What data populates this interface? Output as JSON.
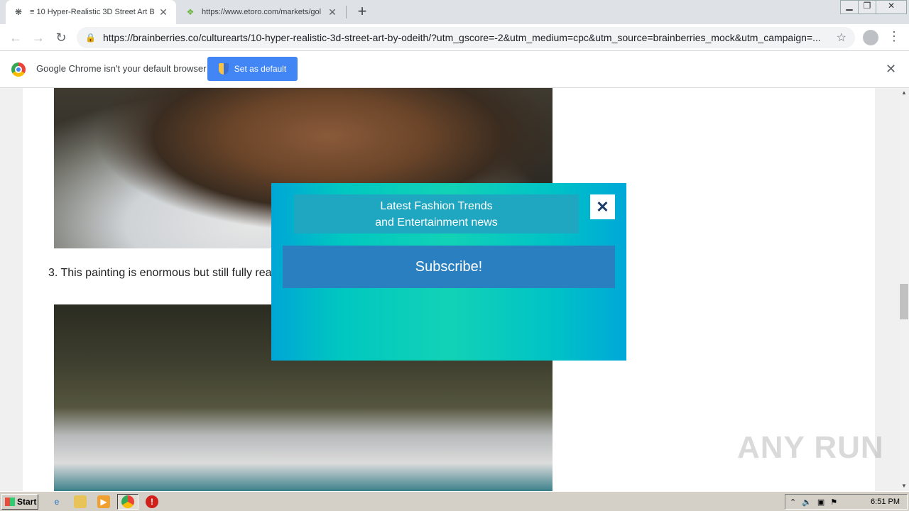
{
  "tabs": [
    {
      "title": "≡ 10 Hyper-Realistic 3D Street Art B",
      "favicon": "brainberries-icon",
      "active": true
    },
    {
      "title": "https://www.etoro.com/markets/gol",
      "favicon": "etoro-icon",
      "active": false
    }
  ],
  "toolbar": {
    "url": "https://brainberries.co/culturearts/10-hyper-realistic-3d-street-art-by-odeith/?utm_gscore=-2&utm_medium=cpc&utm_source=brainberries_mock&utm_campaign=..."
  },
  "infobar": {
    "message": "Google Chrome isn't your default browser",
    "button": "Set as default"
  },
  "article": {
    "caption": "3. This painting is enormous but still fully realistic, it looks like it's a NatGeo shot."
  },
  "popup": {
    "heading_line1": "Latest Fashion Trends",
    "heading_line2": "and Entertainment news",
    "close": "✕",
    "subscribe": "Subscribe!"
  },
  "watermark": "ANY RUN",
  "taskbar": {
    "start": "Start",
    "clock": "6:51 PM"
  }
}
